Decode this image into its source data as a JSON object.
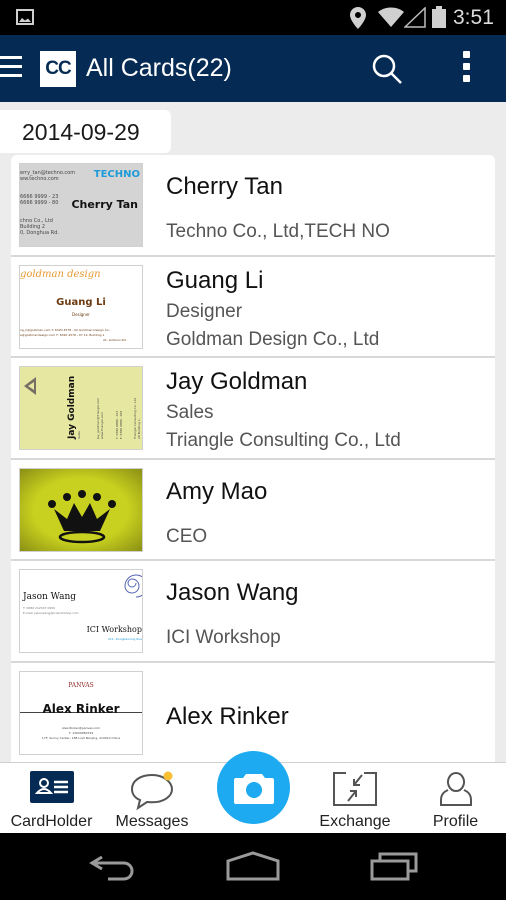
{
  "status_bar": {
    "icons": [
      "gallery-icon",
      "location-icon",
      "wifi-icon",
      "signal-icon",
      "battery-icon"
    ],
    "time": "3:51"
  },
  "app_bar": {
    "logo_text": "CC",
    "title": "All Cards(22)",
    "icons": [
      "menu-icon",
      "search-icon",
      "overflow-menu-icon"
    ],
    "color": "#052b55"
  },
  "date_header": "2014-09-29",
  "cards": [
    {
      "name": "Cherry Tan",
      "lines": [
        "Techno Co., Ltd,TECH NO"
      ],
      "thumb": {
        "brand": "TECHNO",
        "name": "Cherry Tan",
        "lines": [
          "erry_tan@techno.com",
          "ww.techno.com",
          "",
          "6666 9999 - 23",
          "6666 9999 - 80",
          "",
          "chno Co., Ltd",
          "Building 2",
          "0, Donghua Rd."
        ]
      }
    },
    {
      "name": "Guang Li",
      "lines": [
        "Designer",
        "Goldman Design Co., Ltd"
      ],
      "thumb": {
        "brand": "goldman design",
        "name": "Guang Li",
        "sub": "Designer",
        "fine": [
          "ng_li@goldman.com   T: 6320 4578 - 02   Goldman Design Co.,",
          "e@goldmandesign.com   F: 6320 4578 - 07   12, Building 1",
          "21, Linfenlu Rd."
        ]
      }
    },
    {
      "name": "Jay Goldman",
      "lines": [
        "Sales",
        "Triangle Consulting Co., Ltd"
      ],
      "thumb": {
        "name": "Jay Goldman",
        "sub": "Sales",
        "fine": [
          "Jay_goldman@Triangle.com",
          "www.Triangle.com",
          "T: 6780 0889 - 013",
          "F: 6780 0889 - 007",
          "Triangle Consulting Co., Ltd",
          "20 Building 1,",
          "1 Queen's Road"
        ]
      }
    },
    {
      "name": "Amy Mao",
      "lines": [
        "",
        "CEO"
      ],
      "thumb": {
        "art": "crown-logo"
      }
    },
    {
      "name": "Jason Wang",
      "lines": [
        "",
        "ICI Workshop"
      ],
      "thumb": {
        "name": "Jason Wang",
        "fine": [
          "T: 0086 212347 0950",
          "E-mail: jasonwang@iciworkshop.com"
        ],
        "company": "ICI Workshop",
        "address": "211, Dongbaoxing Roa"
      }
    },
    {
      "name": "Alex Rinker",
      "lines": [],
      "thumb": {
        "brand": "PANVAS",
        "name": "Alex Rinker",
        "fine": [
          "Alex.Rinker@panvas.com",
          "T: 13009080729",
          "17F, Sunny Center, 188 Luxt Nanjing, 210019 China"
        ]
      }
    }
  ],
  "tab_bar": {
    "tabs": [
      {
        "label": "CardHolder",
        "icon": "card-holder-icon",
        "active": true
      },
      {
        "label": "Messages",
        "icon": "message-bubble-icon",
        "badge": true
      },
      {
        "label": "Exchange",
        "icon": "exchange-icon"
      },
      {
        "label": "Profile",
        "icon": "profile-icon"
      }
    ],
    "fab_icon": "camera-icon",
    "fab_color": "#1eaaf1",
    "badge_color": "#f5c033"
  },
  "nav_bar": {
    "buttons": [
      "back-icon",
      "home-icon",
      "recent-apps-icon"
    ]
  }
}
